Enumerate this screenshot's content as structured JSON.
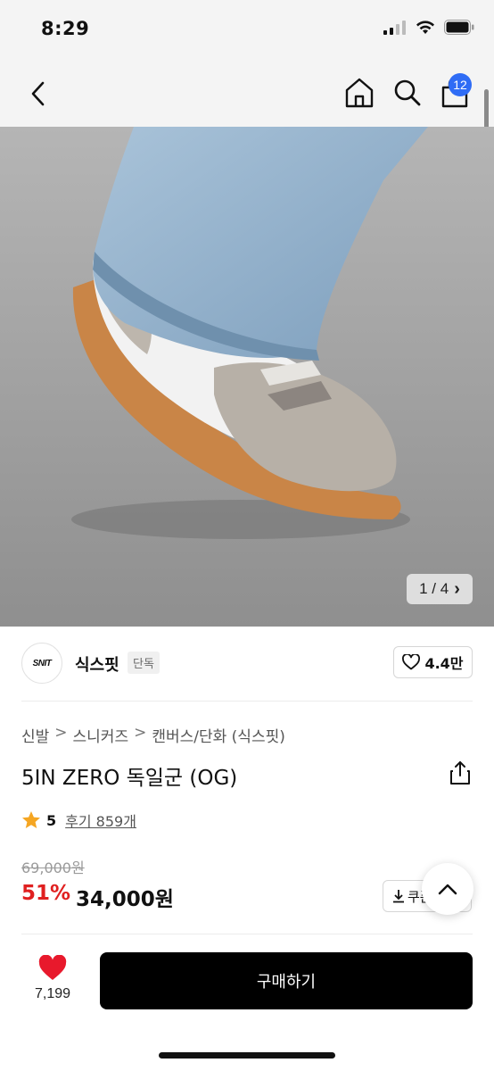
{
  "status_bar": {
    "time": "8:29",
    "icons": [
      "signal-icon",
      "wifi-icon",
      "battery-icon"
    ]
  },
  "nav": {
    "icons": [
      "back-icon",
      "home-icon",
      "search-icon",
      "shopping-bag-icon"
    ],
    "cart_count": "12"
  },
  "image": {
    "counter": "1 / 4",
    "chevron": "›"
  },
  "brand": {
    "logo_text": "SNIT",
    "name": "식스핏",
    "tag": "단독",
    "likes": "4.4만"
  },
  "breadcrumb": [
    "신발",
    "스니커즈",
    "캔버스/단화 (식스핏)"
  ],
  "breadcrumb_separator": ">",
  "product": {
    "title": "5IN ZERO 독일군 (OG)",
    "rating": "5",
    "reviews": "후기 859개"
  },
  "price": {
    "original": "69,000원",
    "discount": "51%",
    "sale": "34,000원",
    "coupon_label": "쿠폰"
  },
  "bottom": {
    "wish_count": "7,199",
    "buy_label": "구매하기"
  },
  "colors": {
    "accent_blue": "#2f6cf5",
    "discount_red": "#e02020",
    "heart_red": "#e8192c",
    "star_orange": "#f5a623",
    "buy_bg": "#000000"
  }
}
